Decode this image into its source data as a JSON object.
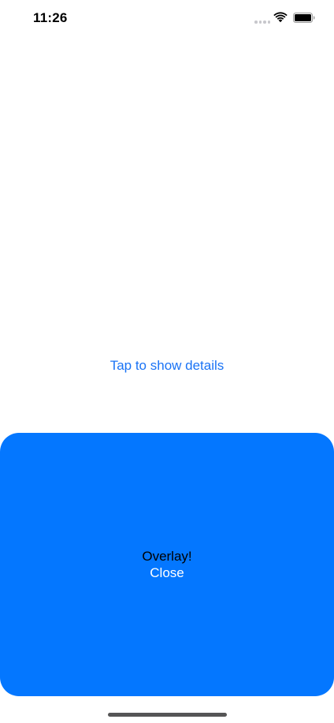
{
  "status_bar": {
    "time": "11:26",
    "signal_icon": "cellular-signal-icon",
    "wifi_icon": "wifi-icon",
    "battery_icon": "battery-icon"
  },
  "main": {
    "show_details_label": "Tap to show details"
  },
  "overlay": {
    "title": "Overlay!",
    "close_label": "Close",
    "background_color": "#0477ff"
  },
  "colors": {
    "link": "#1a73f5",
    "overlay": "#0477ff",
    "background": "#ffffff"
  }
}
